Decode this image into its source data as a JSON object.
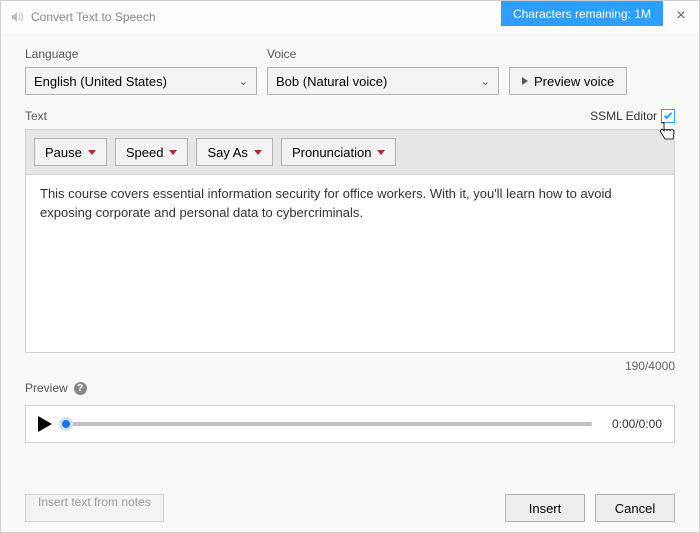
{
  "titlebar": {
    "title": "Convert Text to Speech",
    "characters_remaining": "Characters remaining: 1M"
  },
  "fields": {
    "language_label": "Language",
    "language_value": "English (United States)",
    "voice_label": "Voice",
    "voice_value": "Bob (Natural voice)",
    "preview_voice": "Preview voice"
  },
  "text_section": {
    "label": "Text",
    "ssml_label": "SSML Editor",
    "ssml_checked": true
  },
  "toolbar": {
    "pause": "Pause",
    "speed": "Speed",
    "say_as": "Say As",
    "pronunciation": "Pronunciation"
  },
  "editor": {
    "content": "This course covers essential information security for office workers. With it, you'll learn how to avoid exposing corporate and personal data to cybercriminals.",
    "counter": "190/4000"
  },
  "preview": {
    "label": "Preview",
    "time": "0:00/0:00"
  },
  "footer": {
    "insert_notes": "Insert text from notes",
    "insert": "Insert",
    "cancel": "Cancel"
  }
}
